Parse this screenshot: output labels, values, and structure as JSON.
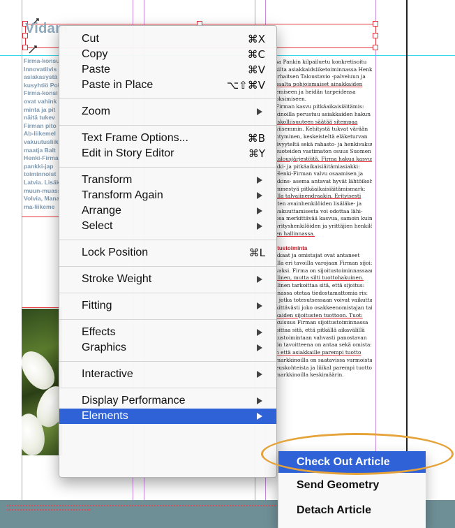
{
  "document": {
    "left_title": "Vidam",
    "left_column_lines": [
      "Firma-konsu",
      "Innovatiivis",
      "asiakasystä",
      "kusyhtiö Pol",
      "Firma-konsi",
      "ovat vahink",
      "minta ja pit",
      "näitä tukev",
      "Firman pito",
      "Ab-liikemel",
      "vakuutusliik",
      "maatja Balt",
      "Henki-Firma",
      "pankki-jap",
      "toiminnoist",
      "Latvia. Lisäk",
      "muun-muass",
      "Volvia, Mana",
      "ma-liikeme"
    ],
    "right_column_lines": [
      "sa Pankin kilpailuetu konkretisoitu",
      "silta asiakkaidsiiketoiminnassa Henki-",
      "irhaitsen Taloustavio -palveluun ja",
      "saalta pohjoismaiset ainakkaiden",
      "emiseen ja heidän tarpeidensa",
      "oksimiseen.",
      "Firman kasvu pitkäaikaisiäitämis:",
      "kinoilla perustuu asiakkaiden hakun",
      "iskolliisuuteen säätää sitempaa",
      "viisemmin. Kehitystä tukvat värään",
      "ntyminen, keskeisteltä eläketurvan",
      "ävyyteltä sekä rahasto- ja henkivakuu-",
      "suoteiden vastimaton osuus Suomen",
      "talousjärjestöitä. Firma hakua kasvus",
      "kki- ja pitkäaikaisiäitämiasiakki:",
      "Henki-Firman valvu osaamisen ja",
      "kkins- asema antavat hyvät lähtöikoh",
      "mmestyä pitkäaikaisiäitämismark:",
      "illa talvaiinendraakin. Erityisesti",
      "iten avainhenkilöiden lisäläke- ja",
      "vakuuttamisesta voi odottaa lähi-",
      "osa merkittävää kasvua, samoin kuin",
      "yrityshenkilöiden ja yrittäjien henkilö:",
      "en hallinnassa."
    ],
    "right_heading": "itustoiminta",
    "right_column_lines_2": [
      "kkaat ja omistajat ovat antaneet",
      "illa eri tavoilla varojaan Firman sijoi:",
      "vaksi. Firma on sijoitustoiminnassaan",
      "llinen, mutta silti tuottohakuinen.",
      "llinen tarkoittaa sitä, että sijoitus:",
      "inassa otetaa tiedostamattomia ris:",
      ", jotka totesutsessaan voivat vaikuttaa",
      "kittävästi joko osakkeenomistajan tai",
      "kaiden sijoitusten tuottoon. Tuot:",
      "kuisuus Firman sijoitustoiminnassa",
      "oittaa sitä, että pitkällä aikavälillä",
      "tustoimintaan vahvasti panostavan",
      "ön tavoitteena on antaa sekä omista:",
      "n että asiakkaille parempi tuotto",
      "markkinoilla on saatavissa varmoista",
      "euskohteista ja liiikal parempi tuotto",
      "markkinoilla keskimäärin."
    ]
  },
  "context_menu": {
    "groups": [
      [
        {
          "label": "Cut",
          "shortcut": "⌘X"
        },
        {
          "label": "Copy",
          "shortcut": "⌘C"
        },
        {
          "label": "Paste",
          "shortcut": "⌘V"
        },
        {
          "label": "Paste in Place",
          "shortcut": "⌥⇧⌘V"
        }
      ],
      [
        {
          "label": "Zoom",
          "submenu": true
        }
      ],
      [
        {
          "label": "Text Frame Options...",
          "shortcut": "⌘B"
        },
        {
          "label": "Edit in Story Editor",
          "shortcut": "⌘Y"
        }
      ],
      [
        {
          "label": "Transform",
          "submenu": true
        },
        {
          "label": "Transform Again",
          "submenu": true
        },
        {
          "label": "Arrange",
          "submenu": true
        },
        {
          "label": "Select",
          "submenu": true
        }
      ],
      [
        {
          "label": "Lock Position",
          "shortcut": "⌘L"
        }
      ],
      [
        {
          "label": "Stroke Weight",
          "submenu": true
        }
      ],
      [
        {
          "label": "Fitting",
          "submenu": true
        }
      ],
      [
        {
          "label": "Effects",
          "submenu": true
        },
        {
          "label": "Graphics",
          "submenu": true
        }
      ],
      [
        {
          "label": "Interactive",
          "submenu": true
        }
      ],
      [
        {
          "label": "Display Performance",
          "submenu": true
        },
        {
          "label": "Elements",
          "submenu": true,
          "selected": true
        }
      ]
    ]
  },
  "submenu": {
    "items": [
      {
        "label": "Check Out Article",
        "selected": true
      },
      {
        "label": "Send Geometry"
      },
      {
        "label": "Detach Article"
      }
    ]
  },
  "colors": {
    "menu_highlight": "#2f62d6",
    "annotation_ring": "#e5a33a",
    "frame_selection": "#e3323c",
    "guide_cyan": "#39d7e6",
    "guide_purple": "#c98be0"
  },
  "icons": [
    "submenu-arrow-icon",
    "anchor-icon"
  ]
}
